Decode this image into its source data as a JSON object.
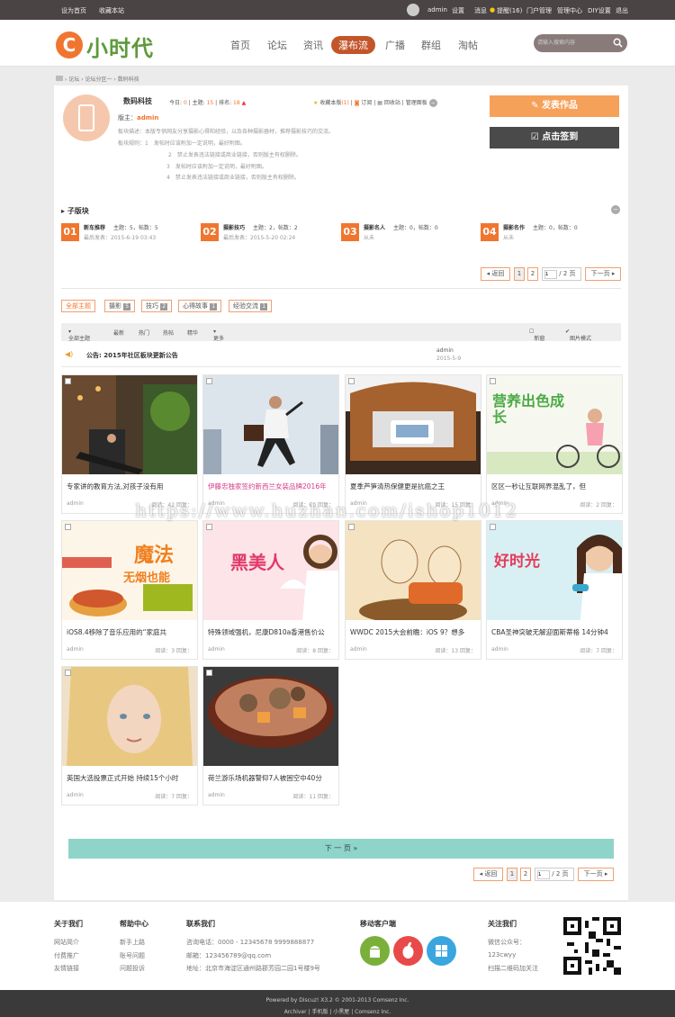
{
  "topbar": {
    "set_home": "设为首页",
    "bookmark": "收藏本站",
    "user": "admin",
    "settings": "设置",
    "messages": "消息",
    "reminders": "提醒(16)",
    "portal_mgmt": "门户管理",
    "admin_center": "管理中心",
    "diy": "DIY设置",
    "logout": "退出"
  },
  "logo": {
    "c": "C",
    "text": "小时代"
  },
  "nav": {
    "items": [
      "首页",
      "论坛",
      "资讯",
      "瀑布流",
      "广播",
      "群组",
      "淘帖"
    ],
    "active": "瀑布流"
  },
  "search": {
    "placeholder": "请输入搜索内容"
  },
  "breadcrumb": {
    "a": "论坛",
    "b": "论坛分区一",
    "c": "数码科技"
  },
  "forum": {
    "name": "数码科技",
    "today_label": "今日:",
    "today": "0",
    "topics_label": "主题:",
    "topics": "15",
    "rank_label": "排名:",
    "rank": "18",
    "fav": "收藏本版",
    "fav_count": "(1)",
    "subscribe": "订阅",
    "recycle": "回收站",
    "manage": "管理面板",
    "moderator_label": "版主：",
    "moderator": "admin",
    "desc": "板块描述：本版专供网友分享摄影心得和经验，以及各种摄影器材，推荐摄影技巧的交流。",
    "rules_label": "板块规则：1",
    "rules": [
      "发帖时应该附加一定说明，最好附图。",
      "禁止发表违法链接或商业链接，否则版主有权删除。",
      "发帖时应该附加一定说明，最好附图。",
      "禁止发表违法链接或商业链接，否则版主有权删除。"
    ],
    "rule_nums": [
      "2",
      "3",
      "4"
    ]
  },
  "actions": {
    "post": "发表作品",
    "signin": "点击签到"
  },
  "subforums": {
    "title": "子版块",
    "items": [
      {
        "num": "01",
        "name": "新车推荐",
        "stats": "主题：5，帖数：5",
        "last": "最后发表：2015-6-19 03:43"
      },
      {
        "num": "02",
        "name": "摄影技巧",
        "stats": "主题：2，帖数：2",
        "last": "最后发表：2015-5-20 02:24"
      },
      {
        "num": "03",
        "name": "摄影名人",
        "stats": "主题：0，帖数：0",
        "last": "从未"
      },
      {
        "num": "04",
        "name": "摄影名作",
        "stats": "主题：0，帖数：0",
        "last": "从未"
      }
    ]
  },
  "pager": {
    "prev": "返回",
    "p1": "1",
    "p2": "2",
    "current": "1",
    "total": "/ 2 页",
    "next": "下一页"
  },
  "tabs": [
    {
      "label": "全部主题",
      "count": ""
    },
    {
      "label": "摄影",
      "count": "5"
    },
    {
      "label": "技巧",
      "count": "2"
    },
    {
      "label": "心得故事",
      "count": "1"
    },
    {
      "label": "经验交流",
      "count": "1"
    }
  ],
  "filters": {
    "all": "全部主题",
    "latest": "最新",
    "hot": "热门",
    "hotpost": "热帖",
    "digest": "精华",
    "more": "更多",
    "newwin": "新窗",
    "imgmode": "图片模式"
  },
  "notice": {
    "label": "公告:",
    "title": "2015年社区板块更新公告",
    "author": "admin",
    "date": "2015-5-9"
  },
  "cards": [
    {
      "title": "专家讲的教育方法,对孩子没有用",
      "author": "admin",
      "views": "阅读：42",
      "replies": "回复：",
      "pink": false
    },
    {
      "title": "伊藤忠独家签约新西兰女装品牌2016年",
      "author": "admin",
      "views": "阅读：60",
      "replies": "回复：",
      "pink": true
    },
    {
      "title": "夏季芦笋清热保健更是抗癌之王",
      "author": "admin",
      "views": "阅读：15",
      "replies": "回复：",
      "pink": false
    },
    {
      "title": "区区一秒让互联网界混乱了，但",
      "author": "admin",
      "views": "阅读：2",
      "replies": "回复：",
      "pink": false
    },
    {
      "title": "iOS8.4移除了音乐应用的“家庭共",
      "author": "admin",
      "views": "阅读：3",
      "replies": "回复：",
      "pink": false
    },
    {
      "title": "特殊领域强机，尼康D810a香港售价公",
      "author": "admin",
      "views": "阅读：8",
      "replies": "回复：",
      "pink": false
    },
    {
      "title": "WWDC 2015大会前瞻：iOS 9？想多",
      "author": "admin",
      "views": "阅读：13",
      "replies": "回复：",
      "pink": false
    },
    {
      "title": "CBA圣神突破无解迎面斯蒂格 14分钟4",
      "author": "admin",
      "views": "阅读：7",
      "replies": "回复：",
      "pink": false
    },
    {
      "title": "英国大选投票正式开始 持续15个小时",
      "author": "admin",
      "views": "阅读：7",
      "replies": "回复：",
      "pink": false
    },
    {
      "title": "荷兰游乐场机器警仰7人被困空中40分",
      "author": "admin",
      "views": "阅读：11",
      "replies": "回复：",
      "pink": false
    }
  ],
  "image_text": {
    "c2": "魔法",
    "c2b": "无烟也能",
    "c3": "黑美人",
    "c4": "好时光",
    "c1": "营养出色成长"
  },
  "load_more": "下 一 页  »",
  "footer": {
    "about": {
      "title": "关于我们",
      "links": [
        "网站简介",
        "付费推广",
        "友情链接"
      ]
    },
    "help": {
      "title": "帮助中心",
      "links": [
        "新手上路",
        "账号问题",
        "问题投诉"
      ]
    },
    "contact": {
      "title": "联系我们",
      "lines": [
        "咨询电话：0000 - 12345678 9999888877",
        "邮箱：123456789@qq.com",
        "地址：北京市海淀区通州路郡芳园二园1号楼9号"
      ]
    },
    "mobile": {
      "title": "移动客户端"
    },
    "follow": {
      "title": "关注我们",
      "lines": [
        "微信公众号：",
        "123cwyy",
        "扫描二维码加关注"
      ]
    }
  },
  "bottom": {
    "powered": "Powered by Discuz! X3.2 © 2001-2013 Comsenz Inc.",
    "links": "Archiver  |  手机版  |  小黑屋  |  Comsenz Inc."
  },
  "watermark": "https://www.huzhan.com/ishop1012"
}
